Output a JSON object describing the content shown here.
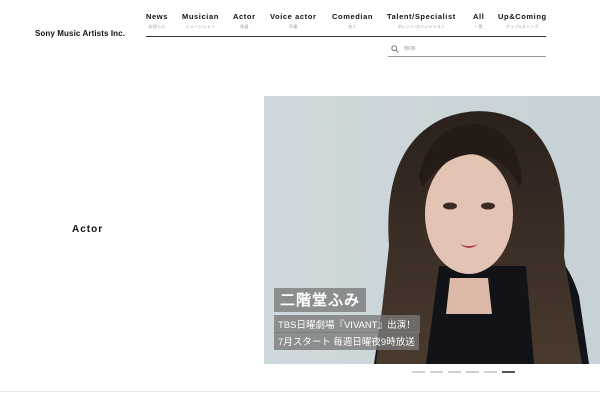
{
  "header": {
    "logo": "Sony Music Artists Inc.",
    "nav": [
      {
        "en": "News",
        "ja": "お知らせ"
      },
      {
        "en": "Musician",
        "ja": "ミュージシャン"
      },
      {
        "en": "Actor",
        "ja": "俳優"
      },
      {
        "en": "Voice actor",
        "ja": "声優"
      },
      {
        "en": "Comedian",
        "ja": "芸人"
      },
      {
        "en": "Talent/Specialist",
        "ja": "タレント/スペシャリスト"
      },
      {
        "en": "All",
        "ja": "一覧"
      },
      {
        "en": "Up&Coming",
        "ja": "アップ&カミング"
      }
    ]
  },
  "search": {
    "placeholder": "検索",
    "icon": "search-icon"
  },
  "side_label": "Actor",
  "hero": {
    "name": "二階堂ふみ",
    "line1": "TBS日曜劇場『VIVANT』出演！",
    "line2": "7月スタート 毎週日曜夜9時放送"
  },
  "carousel": {
    "count": 6,
    "active_index": 5
  },
  "colors": {
    "accent": "#111111",
    "caption_bg": "#787878",
    "hero_bg": "#cfd9dc"
  }
}
